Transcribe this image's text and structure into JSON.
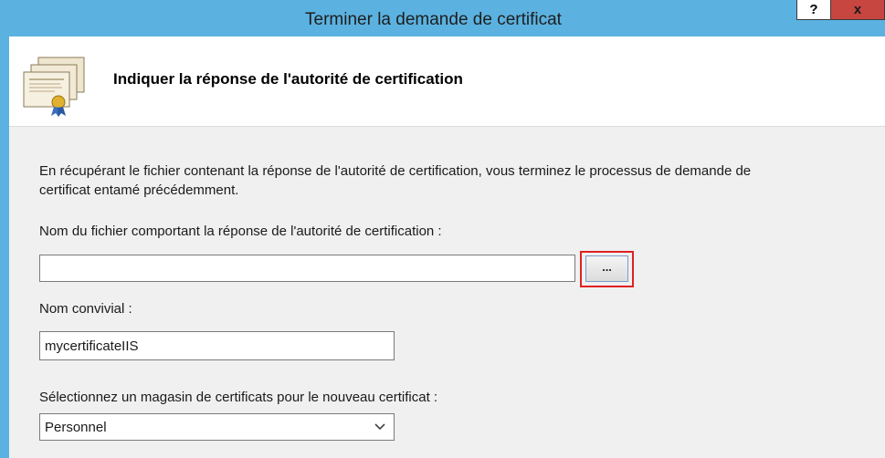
{
  "window": {
    "title": "Terminer la demande de certificat",
    "help_label": "?",
    "close_label": "x"
  },
  "header": {
    "title": "Indiquer la réponse de l'autorité de certification"
  },
  "content": {
    "description": "En récupérant le fichier contenant la réponse de l'autorité de certification, vous terminez le processus de demande de certificat entamé précédemment.",
    "file_label": "Nom du fichier comportant la réponse de l'autorité de certification :",
    "file_value": "",
    "browse_label": "...",
    "friendly_label": "Nom convivial :",
    "friendly_value": "mycertificateIIS",
    "store_label": "Sélectionnez un magasin de certificats pour le nouveau certificat :",
    "store_value": "Personnel"
  },
  "colors": {
    "titlebar": "#5bb2e0",
    "close_button": "#c7463f",
    "highlight": "#e02121"
  },
  "icons": {
    "header": "certificate-icon",
    "dropdown": "chevron-down-icon"
  }
}
